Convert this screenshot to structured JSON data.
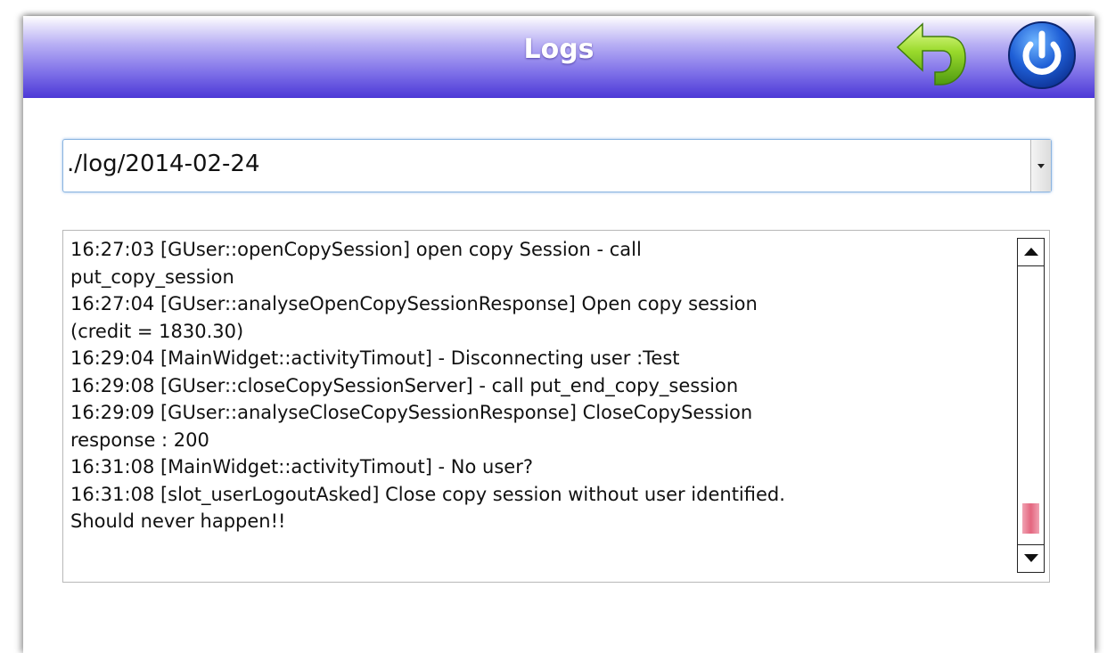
{
  "window": {
    "title": "Logs"
  },
  "toolbar": {
    "back_icon": "back-arrow-icon",
    "power_icon": "power-icon"
  },
  "log_selector": {
    "selected": "./log/2014-02-24"
  },
  "log": {
    "lines": [
      "16:27:03 [GUser::openCopySession] open copy Session - call",
      "put_copy_session",
      "16:27:04 [GUser::analyseOpenCopySessionResponse] Open copy session",
      "(credit = 1830.30)",
      "16:29:04 [MainWidget::activityTimout] - Disconnecting user :Test",
      "16:29:08 [GUser::closeCopySessionServer] - call put_end_copy_session",
      "16:29:09 [GUser::analyseCloseCopySessionResponse] CloseCopySession",
      "response : 200",
      "16:31:08 [MainWidget::activityTimout] - No user?",
      "16:31:08 [slot_userLogoutAsked] Close copy session without user identified.",
      "Should never happen!!"
    ],
    "scroll_position": 0.97
  },
  "colors": {
    "titlebar_accent": "#4c38d6",
    "back_arrow": "#7cc81e",
    "power_button": "#1f5fd6",
    "scroll_thumb": "#e4667f"
  }
}
